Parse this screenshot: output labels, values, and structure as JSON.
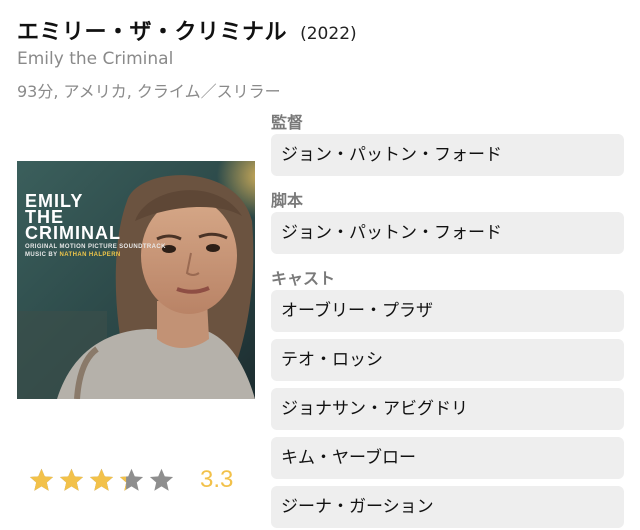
{
  "movie": {
    "title": "エミリー・ザ・クリミナル",
    "year": "(2022)",
    "original_title": "Emily the Criminal",
    "meta": "93分, アメリカ, クライム／スリラー"
  },
  "poster": {
    "title_line1": "EMILY",
    "title_line2": "THE",
    "title_line3": "CRIMINAL",
    "subtitle": "ORIGINAL MOTION PICTURE SOUNDTRACK",
    "music_prefix": "MUSIC BY",
    "music_name": "NATHAN HALPERN"
  },
  "rating": {
    "value": "3.3",
    "stars_filled": 3.3,
    "stars_total": 5,
    "color_filled": "#f2c14a",
    "color_empty": "#8e8e8e"
  },
  "credits": {
    "director_label": "監督",
    "director": "ジョン・パットン・フォード",
    "writer_label": "脚本",
    "writer": "ジョン・パットン・フォード",
    "cast_label": "キャスト",
    "cast": [
      "オーブリー・プラザ",
      "テオ・ロッシ",
      "ジョナサン・アビグドリ",
      "キム・ヤーブロー",
      "ジーナ・ガーション"
    ]
  }
}
